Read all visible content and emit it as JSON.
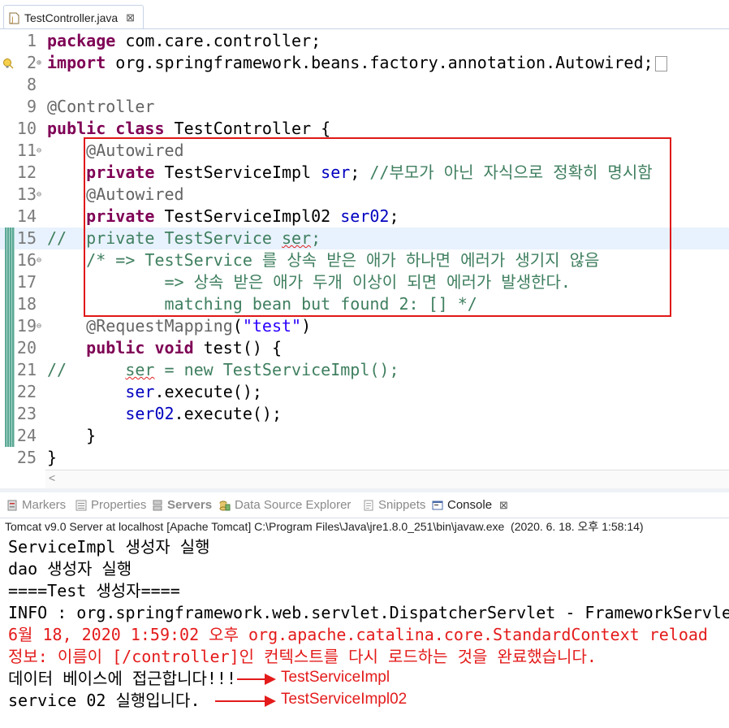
{
  "editor": {
    "tab_title": "TestController.java",
    "tab_close": "⊠",
    "lines": [
      {
        "num": "1",
        "tokens": [
          {
            "t": "package",
            "c": "kw"
          },
          {
            "t": " com.care.controller;"
          }
        ]
      },
      {
        "num": "2",
        "fold": "⊕",
        "warning": true,
        "collapsed": true,
        "tokens": [
          {
            "t": "import",
            "c": "kw"
          },
          {
            "t": " org.springframework.beans.factory.annotation.Autowired;"
          }
        ]
      },
      {
        "num": "8",
        "tokens": []
      },
      {
        "num": "9",
        "tokens": [
          {
            "t": "@Controller",
            "c": "ann"
          }
        ]
      },
      {
        "num": "10",
        "tokens": [
          {
            "t": "public",
            "c": "kw"
          },
          {
            "t": " "
          },
          {
            "t": "class",
            "c": "kw"
          },
          {
            "t": " TestController {"
          }
        ]
      },
      {
        "num": "11",
        "fold": "⊖",
        "tokens": [
          {
            "t": "    "
          },
          {
            "t": "@Autowired",
            "c": "ann"
          }
        ]
      },
      {
        "num": "12",
        "tokens": [
          {
            "t": "    "
          },
          {
            "t": "private",
            "c": "kw"
          },
          {
            "t": " TestServiceImpl "
          },
          {
            "t": "ser",
            "c": "fld"
          },
          {
            "t": "; "
          },
          {
            "t": "//부모가 아닌 자식으로 정확히 명시함",
            "c": "cm"
          }
        ]
      },
      {
        "num": "13",
        "fold": "⊖",
        "tokens": [
          {
            "t": "    "
          },
          {
            "t": "@Autowired",
            "c": "ann"
          }
        ]
      },
      {
        "num": "14",
        "tokens": [
          {
            "t": "    "
          },
          {
            "t": "private",
            "c": "kw"
          },
          {
            "t": " TestServiceImpl02 "
          },
          {
            "t": "ser02",
            "c": "fld"
          },
          {
            "t": ";"
          }
        ]
      },
      {
        "num": "15",
        "highlight": true,
        "changed": true,
        "tokens": [
          {
            "t": "//  private TestService ",
            "c": "cm"
          },
          {
            "t": "ser",
            "c": "cm squig"
          },
          {
            "t": ";",
            "c": "cm"
          }
        ]
      },
      {
        "num": "16",
        "fold": "⊖",
        "changed": true,
        "tokens": [
          {
            "t": "    "
          },
          {
            "t": "/* => TestService 를 상속 받은 애가 하나면 에러가 생기지 않음",
            "c": "cm"
          }
        ]
      },
      {
        "num": "17",
        "changed": true,
        "tokens": [
          {
            "t": "            => 상속 받은 애가 두개 이상이 되면 에러가 발생한다.",
            "c": "cm"
          }
        ]
      },
      {
        "num": "18",
        "changed": true,
        "tokens": [
          {
            "t": "            matching bean but found 2: [] */",
            "c": "cm"
          }
        ]
      },
      {
        "num": "19",
        "fold": "⊖",
        "changed": true,
        "tokens": [
          {
            "t": "    "
          },
          {
            "t": "@RequestMapping",
            "c": "ann"
          },
          {
            "t": "("
          },
          {
            "t": "\"test\"",
            "c": "str"
          },
          {
            "t": ")"
          }
        ]
      },
      {
        "num": "20",
        "changed": true,
        "tokens": [
          {
            "t": "    "
          },
          {
            "t": "public",
            "c": "kw"
          },
          {
            "t": " "
          },
          {
            "t": "void",
            "c": "kw"
          },
          {
            "t": " test() {"
          }
        ]
      },
      {
        "num": "21",
        "changed": true,
        "tokens": [
          {
            "t": "//      ",
            "c": "cm"
          },
          {
            "t": "ser",
            "c": "cm squig"
          },
          {
            "t": " = new TestServiceImpl();",
            "c": "cm"
          }
        ]
      },
      {
        "num": "22",
        "changed": true,
        "tokens": [
          {
            "t": "        "
          },
          {
            "t": "ser",
            "c": "fld"
          },
          {
            "t": ".execute();"
          }
        ]
      },
      {
        "num": "23",
        "changed": true,
        "tokens": [
          {
            "t": "        "
          },
          {
            "t": "ser02",
            "c": "fld"
          },
          {
            "t": ".execute();"
          }
        ]
      },
      {
        "num": "24",
        "changed": true,
        "tokens": [
          {
            "t": "    }"
          }
        ]
      },
      {
        "num": "25",
        "tokens": [
          {
            "t": "}"
          }
        ]
      }
    ],
    "scroll_left": "<"
  },
  "views": {
    "tabs": [
      {
        "label": "Markers",
        "icon": "markers-icon",
        "active": false
      },
      {
        "label": "Properties",
        "icon": "properties-icon",
        "active": false
      },
      {
        "label": "Servers",
        "icon": "servers-icon",
        "active": false,
        "bold": true
      },
      {
        "label": "Data Source Explorer",
        "icon": "data-source-icon",
        "active": false
      },
      {
        "label": "Snippets",
        "icon": "snippets-icon",
        "active": false
      },
      {
        "label": "Console",
        "icon": "console-icon",
        "active": true,
        "close": "⊠"
      }
    ],
    "console_title": "Tomcat v9.0 Server at localhost [Apache Tomcat] C:\\Program Files\\Java\\jre1.8.0_251\\bin\\javaw.exe  (2020. 6. 18. 오후 1:58:14)"
  },
  "console": {
    "lines": [
      {
        "text": "ServiceImpl 생성자 실행",
        "red": false
      },
      {
        "text": "dao 생성자 실행",
        "red": false
      },
      {
        "text": "====Test 생성자====",
        "red": false
      },
      {
        "text": "INFO : org.springframework.web.servlet.DispatcherServlet - FrameworkServlet 'appServlet': initialization completed",
        "red": false
      },
      {
        "text": "6월 18, 2020 1:59:02 오후 org.apache.catalina.core.StandardContext reload",
        "red": true
      },
      {
        "text": "정보: 이름이 [/controller]인 컨텍스트를 다시 로드하는 것을 완료했습니다.",
        "red": true
      },
      {
        "text": "데이터 베이스에 접근합니다!!!",
        "red": false
      },
      {
        "text": "service 02 실행입니다.",
        "red": false
      }
    ],
    "annotations": [
      {
        "label": "TestServiceImpl"
      },
      {
        "label": "TestServiceImpl02"
      }
    ]
  },
  "colors": {
    "keyword": "#7f0055",
    "annotation": "#646464",
    "comment": "#3f7f5f",
    "string": "#2a00ff",
    "field": "#0000c0",
    "highlight_box": "#e01818",
    "console_error": "#e41b1b"
  }
}
